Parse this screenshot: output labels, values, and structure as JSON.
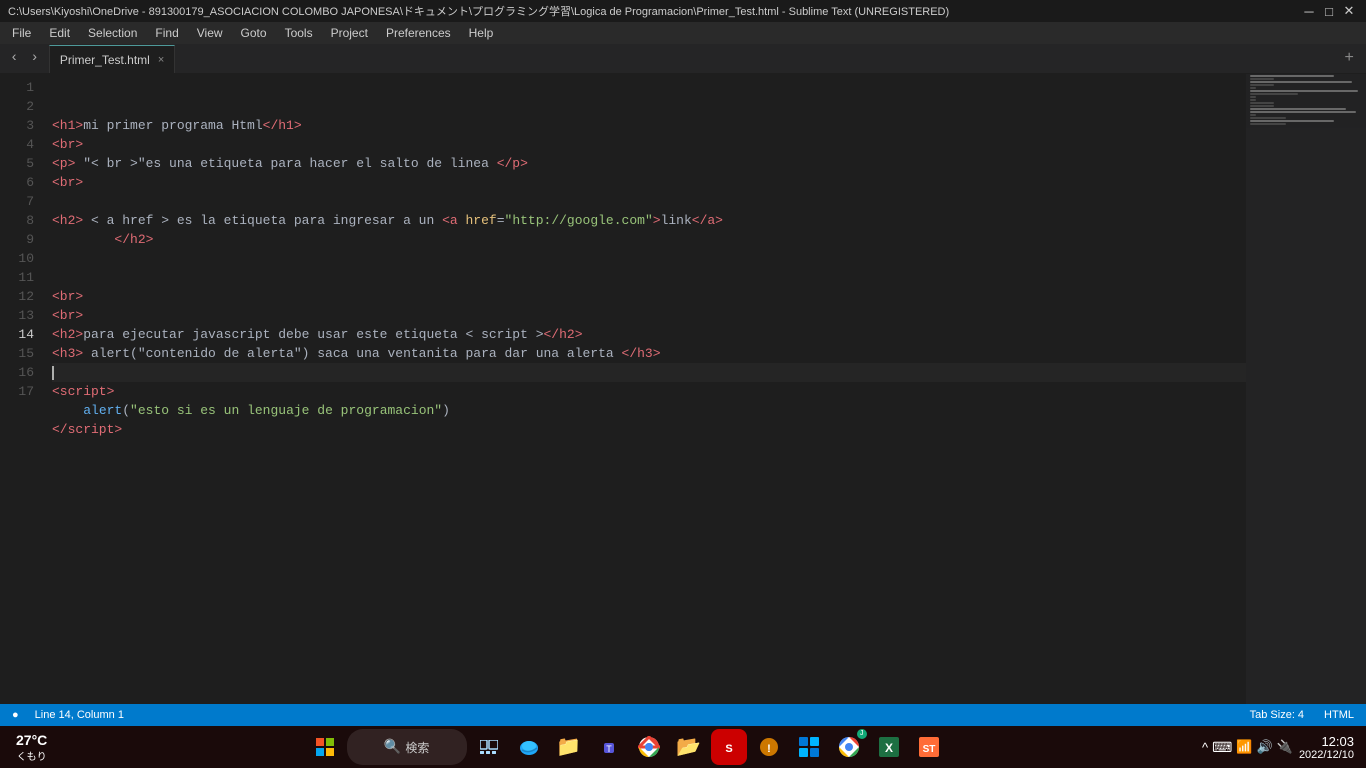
{
  "titlebar": {
    "title": "C:\\Users\\Kiyoshi\\OneDrive - 891300179_ASOCIACION COLOMBO JAPONESA\\ドキュメント\\プログラミング学習\\Logica de Programacion\\Primer_Test.html - Sublime Text (UNREGISTERED)",
    "minimize": "─",
    "maximize": "□",
    "close": "✕"
  },
  "menubar": {
    "items": [
      "File",
      "Edit",
      "Selection",
      "Find",
      "View",
      "Goto",
      "Tools",
      "Project",
      "Preferences",
      "Help"
    ]
  },
  "tabbar": {
    "tab_name": "Primer_Test.html",
    "close_tab": "×"
  },
  "status": {
    "indicator": "●",
    "position": "Line 14, Column 1",
    "tab_size": "Tab Size: 4",
    "language": "HTML"
  },
  "code_lines": [
    {
      "num": 1,
      "active": false,
      "html": "<span class='tag'>&lt;h1&gt;</span><span class='text-content'>mi primer programa Html</span><span class='tag'>&lt;/h1&gt;</span>"
    },
    {
      "num": 2,
      "active": false,
      "html": "<span class='tag'>&lt;br&gt;</span>"
    },
    {
      "num": 3,
      "active": false,
      "html": "<span class='tag'>&lt;p&gt;</span><span class='text-content'> \"&lt; br &gt;\"es una etiqueta para hacer el salto de linea </span><span class='tag'>&lt;/p&gt;</span>"
    },
    {
      "num": 4,
      "active": false,
      "html": "<span class='tag'>&lt;br&gt;</span>"
    },
    {
      "num": 5,
      "active": false,
      "html": ""
    },
    {
      "num": 6,
      "active": false,
      "html": "<span class='tag'>&lt;h2&gt;</span><span class='text-content'> &lt; a href &gt; es la etiqueta para ingresar a un </span><span class='tag'>&lt;a </span><span class='attr-name'>href</span><span class='text-content'>=</span><span class='attr-val'>\"http://google.com\"</span><span class='tag'>&gt;</span><span class='text-content'>link</span><span class='tag'>&lt;/a&gt;</span>"
    },
    {
      "num": 7,
      "active": false,
      "html": "<span class='text-content'>        </span><span class='tag'>&lt;/h2&gt;</span>"
    },
    {
      "num": 8,
      "active": false,
      "html": ""
    },
    {
      "num": 9,
      "active": false,
      "html": ""
    },
    {
      "num": 10,
      "active": false,
      "html": "<span class='tag'>&lt;br&gt;</span>"
    },
    {
      "num": 11,
      "active": false,
      "html": "<span class='tag'>&lt;br&gt;</span>"
    },
    {
      "num": 12,
      "active": false,
      "html": "<span class='tag'>&lt;h2&gt;</span><span class='text-content'>para ejecutar javascript debe usar este etiqueta &lt; script &gt;</span><span class='tag'>&lt;/h2&gt;</span>"
    },
    {
      "num": 13,
      "active": false,
      "html": "<span class='tag'>&lt;h3&gt;</span><span class='text-content'> alert(\"contenido de alerta\") saca una ventanita para dar una alerta </span><span class='tag'>&lt;/h3&gt;</span>"
    },
    {
      "num": 14,
      "active": true,
      "html": "<span class='cursor-line'></span>"
    },
    {
      "num": 15,
      "active": false,
      "html": "<span class='tag'>&lt;script&gt;</span>"
    },
    {
      "num": 16,
      "active": false,
      "html": "<span class='text-content'>    </span><span class='fn-call'>alert</span><span class='text-content'>(</span><span class='attr-val'>\"esto si es un lenguaje de programacion\"</span><span class='text-content'>)</span>"
    },
    {
      "num": 17,
      "active": false,
      "html": "<span class='tag'>&lt;/script&gt;</span>"
    }
  ],
  "taskbar": {
    "weather_temp": "27°C",
    "weather_desc": "くもり",
    "time": "12:03",
    "date": "2022/12/10",
    "search_label": "検索"
  }
}
